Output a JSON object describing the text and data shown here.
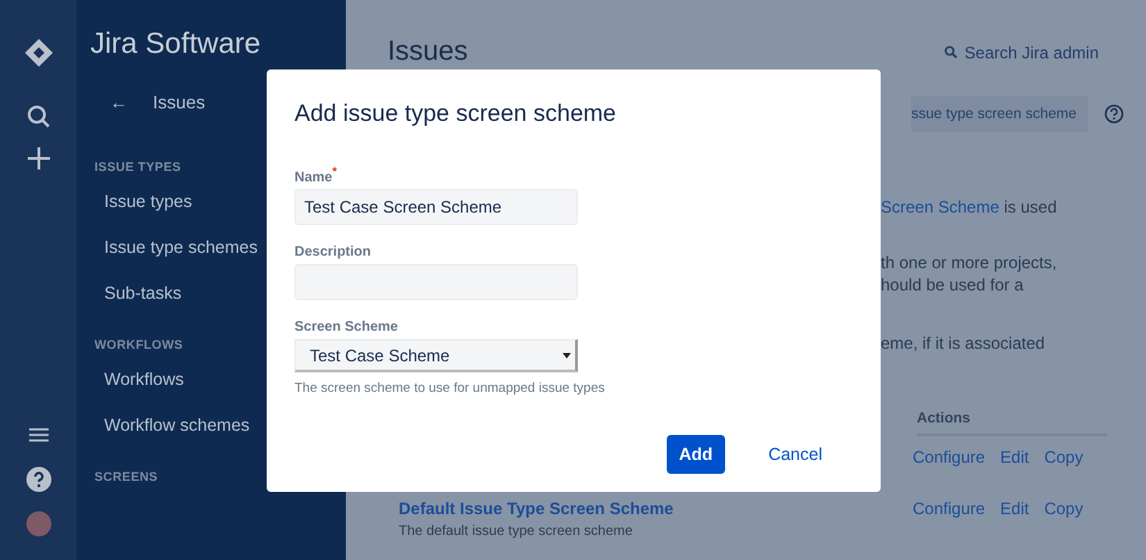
{
  "product": {
    "name": "Jira Software"
  },
  "sidebar": {
    "back": {
      "arrow": "←",
      "label": "Issues"
    },
    "sections": [
      {
        "heading": "ISSUE TYPES",
        "items": [
          {
            "label": "Issue types"
          },
          {
            "label": "Issue type schemes"
          },
          {
            "label": "Sub-tasks"
          }
        ]
      },
      {
        "heading": "WORKFLOWS",
        "items": [
          {
            "label": "Workflows"
          },
          {
            "label": "Workflow schemes"
          }
        ]
      },
      {
        "heading": "SCREENS"
      }
    ]
  },
  "page": {
    "title": "Issues",
    "search": "Search Jira admin",
    "add_button": "ssue type screen scheme",
    "intro": [
      {
        "link": "Screen Scheme",
        "text": " is used"
      },
      {
        "text": "th one or more projects,"
      },
      {
        "text": "hould be used for a"
      },
      {
        "text": "eme, if it is associated"
      }
    ],
    "table": {
      "columns": [
        {
          "label": "Actions"
        }
      ],
      "rows": [
        {
          "actions": [
            "Configure",
            "Edit",
            "Copy"
          ]
        },
        {
          "name": "Default Issue Type Screen Scheme",
          "description": "The default issue type screen scheme",
          "actions": [
            "Configure",
            "Edit",
            "Copy"
          ]
        }
      ]
    }
  },
  "dialog": {
    "title": "Add issue type screen scheme",
    "fields": [
      {
        "kind": "text",
        "label": "Name",
        "required_mark": "*",
        "value": "Test Case Screen Scheme"
      },
      {
        "kind": "text",
        "label": "Description"
      },
      {
        "kind": "select",
        "label": "Screen Scheme",
        "value": "Test Case Scheme",
        "help": "The screen scheme to use for unmapped issue types"
      }
    ],
    "buttons": [
      {
        "kind": "primary",
        "label": "Add"
      },
      {
        "kind": "link",
        "label": "Cancel"
      }
    ]
  }
}
